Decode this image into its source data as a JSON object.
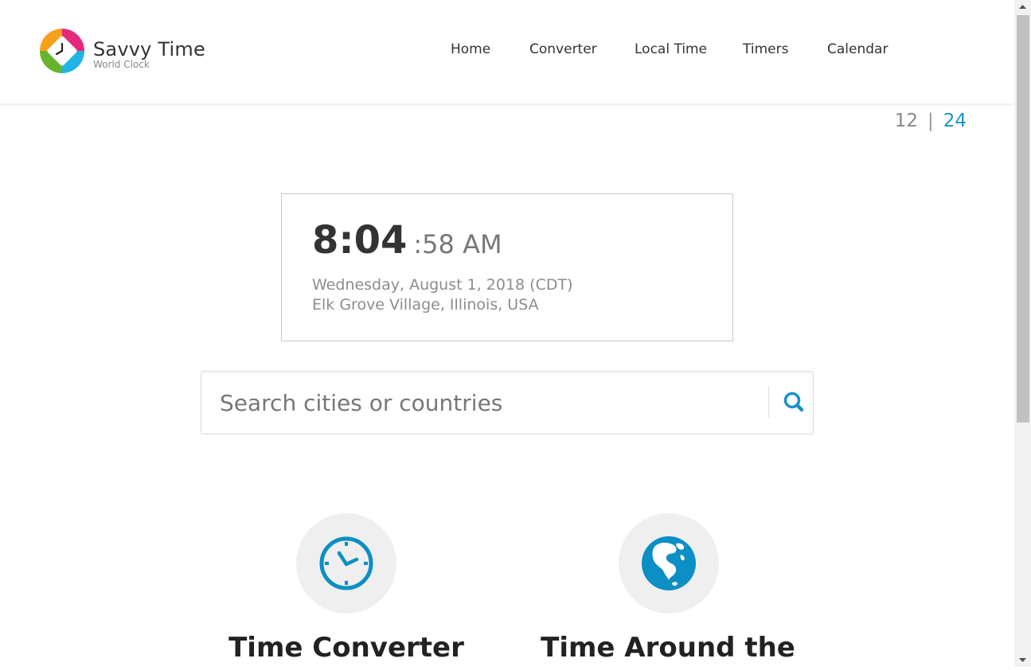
{
  "header": {
    "brand_name": "Savvy Time",
    "brand_subtitle": "World Clock",
    "logo_icon": "clock-logo-icon",
    "nav": [
      {
        "label": "Home"
      },
      {
        "label": "Converter"
      },
      {
        "label": "Local Time"
      },
      {
        "label": "Timers"
      },
      {
        "label": "Calendar"
      }
    ]
  },
  "format_toggle": {
    "option_12": "12",
    "separator": "|",
    "option_24": "24",
    "active": "24"
  },
  "clock": {
    "time_main": "8:04",
    "time_seconds": ":58 AM",
    "date": "Wednesday, August 1, 2018 (CDT)",
    "location": "Elk Grove Village, Illinois, USA"
  },
  "search": {
    "placeholder": "Search cities or countries",
    "value": "",
    "icon": "search-icon"
  },
  "features": [
    {
      "title": "Time Converter",
      "icon": "clock-icon"
    },
    {
      "title": "Time Around the",
      "icon": "globe-icon"
    }
  ],
  "colors": {
    "accent": "#1a95c4",
    "icon_blue": "#0b8fc4",
    "text_dark": "#333333",
    "text_muted": "#8c8c8c",
    "icon_circle_bg": "#efefef"
  }
}
